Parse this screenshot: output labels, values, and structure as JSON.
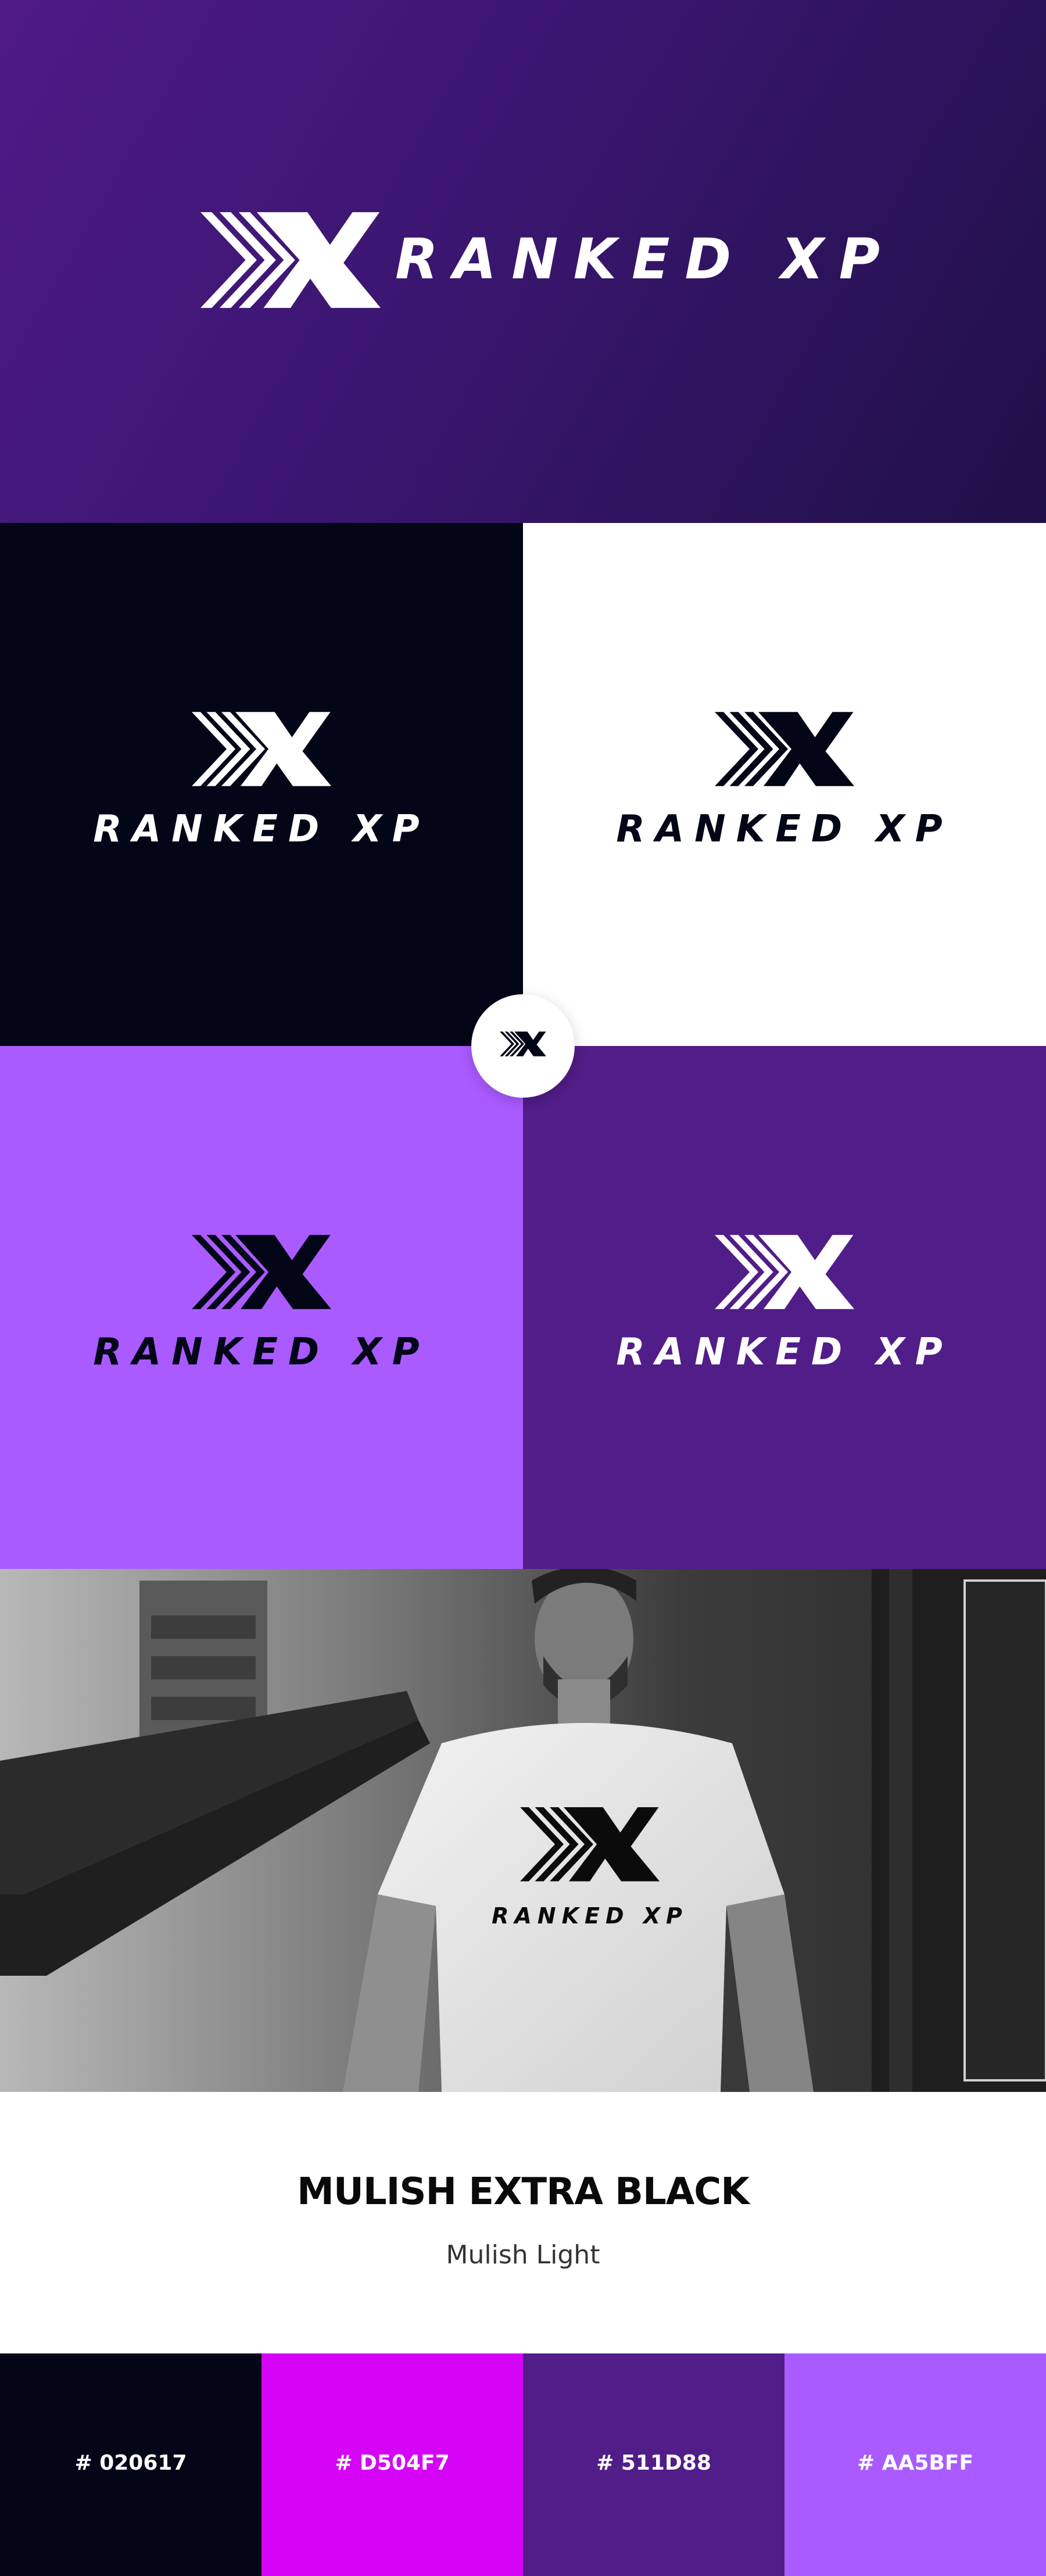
{
  "brand": {
    "logo_text": "RANKED XP",
    "mark_icon": "ranked-xp-chevron-x-icon"
  },
  "panels": [
    {
      "name": "dark",
      "background": "#020617",
      "logo_color": "#ffffff"
    },
    {
      "name": "white",
      "background": "#ffffff",
      "logo_color": "#020617"
    },
    {
      "name": "light-purple",
      "background": "#AA5BFF",
      "logo_color": "#020617"
    },
    {
      "name": "deep-purple",
      "background": "#511D88",
      "logo_color": "#ffffff"
    }
  ],
  "typography": {
    "heading": "MULISH EXTRA BLACK",
    "body": "Mulish Light"
  },
  "palette": [
    {
      "label": "# 020617",
      "color": "#020617"
    },
    {
      "label": "# D504F7",
      "color": "#D504F7"
    },
    {
      "label": "# 511D88",
      "color": "#511D88"
    },
    {
      "label": "# AA5BFF",
      "color": "#AA5BFF"
    }
  ]
}
